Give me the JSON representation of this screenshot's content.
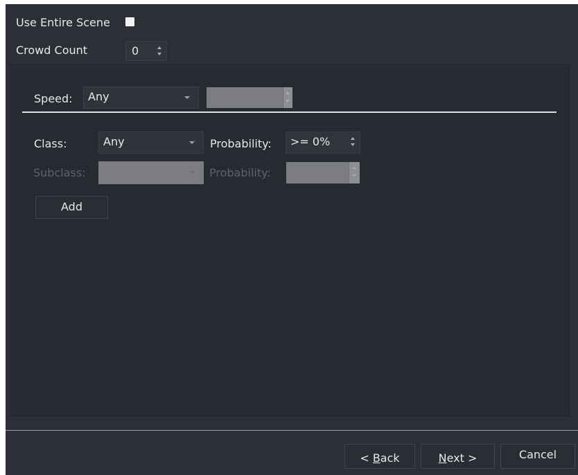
{
  "top": {
    "use_entire_scene_label": "Use Entire Scene",
    "use_entire_scene_checked": false,
    "crowd_count_label": "Crowd Count",
    "crowd_count_value": "0"
  },
  "filter": {
    "speed_label": "Speed:",
    "speed_value": "Any",
    "class_label": "Class:",
    "class_value": "Any",
    "class_probability_label": "Probability:",
    "class_probability_value": ">= 0%",
    "subclass_label": "Subclass:",
    "subclass_probability_label": "Probability:",
    "add_label": "Add"
  },
  "footer": {
    "back_prefix": "< ",
    "back_mnemonic": "B",
    "back_rest": "ack",
    "next_mnemonic": "N",
    "next_rest": "ext >",
    "cancel_label": "Cancel"
  }
}
